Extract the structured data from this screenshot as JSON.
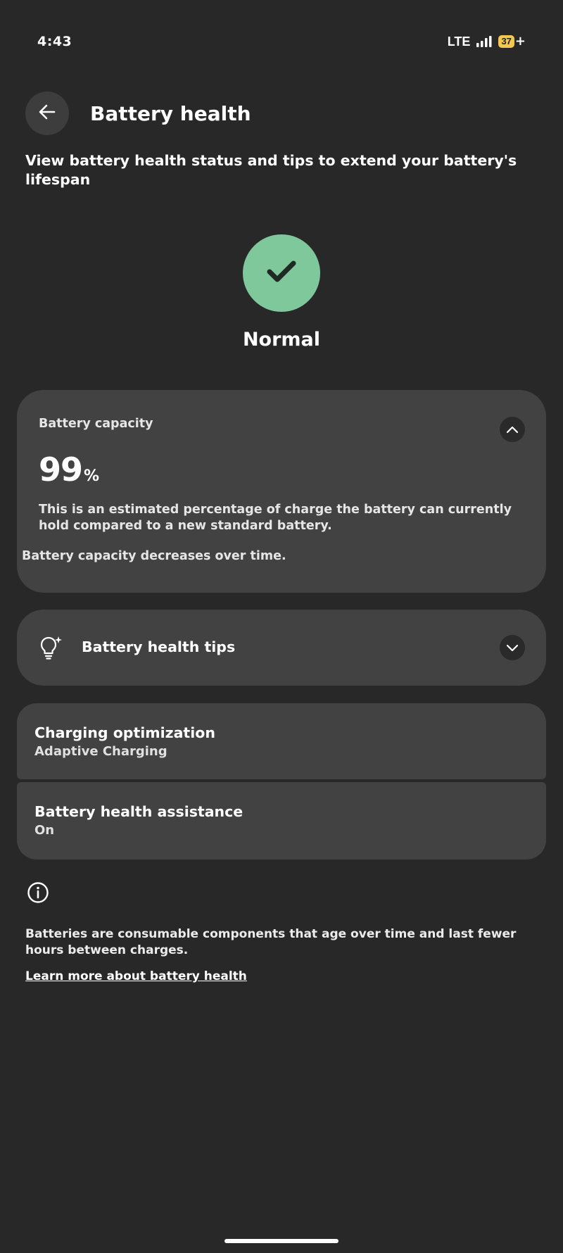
{
  "status_bar": {
    "time": "4:43",
    "network": "LTE",
    "battery_level": "37",
    "charging_symbol": "+"
  },
  "header": {
    "back_icon": "arrow-left-icon",
    "title": "Battery health"
  },
  "subtitle": "View battery health status and tips to extend your battery's lifespan",
  "status": {
    "icon": "checkmark-icon",
    "label": "Normal",
    "color": "#7ec89b"
  },
  "capacity_card": {
    "label": "Battery capacity",
    "value": "99",
    "unit": "%",
    "description": "This is an estimated percentage of charge the battery can currently hold compared to a new standard battery.",
    "note": "Battery capacity decreases over time.",
    "toggle_icon": "chevron-up-icon"
  },
  "tips_card": {
    "icon": "lightbulb-sparkle-icon",
    "label": "Battery health tips",
    "toggle_icon": "chevron-down-icon"
  },
  "settings": [
    {
      "title": "Charging optimization",
      "subtitle": "Adaptive Charging"
    },
    {
      "title": "Battery health assistance",
      "subtitle": "On"
    }
  ],
  "footer": {
    "icon": "info-icon",
    "text": "Batteries are consumable components that age over time and last fewer hours between charges.",
    "link": "Learn more about battery health"
  },
  "colors": {
    "background": "#282828",
    "card": "#424242",
    "accent_green": "#7ec89b",
    "battery_badge": "#f2c94c"
  }
}
